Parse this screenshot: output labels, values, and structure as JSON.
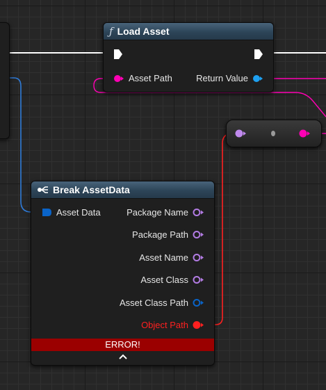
{
  "load_asset_node": {
    "title": "Load Asset",
    "icon": "function-icon",
    "inputs": [
      {
        "label": "Asset Path",
        "color": "#ff00b4"
      }
    ],
    "outputs": [
      {
        "label": "Return Value",
        "color": "#1ea0f0"
      }
    ]
  },
  "break_asset_data_node": {
    "title": "Break AssetData",
    "icon": "break-struct-icon",
    "inputs": [
      {
        "label": "Asset Data",
        "color": "#0a64c8"
      }
    ],
    "outputs": [
      {
        "label": "Package Name",
        "color": "#b37ce4"
      },
      {
        "label": "Package Path",
        "color": "#b37ce4"
      },
      {
        "label": "Asset Name",
        "color": "#b37ce4"
      },
      {
        "label": "Asset Class",
        "color": "#b37ce4"
      },
      {
        "label": "Asset Class Path",
        "color": "#0a64c8"
      },
      {
        "label": "Object Path",
        "color": "#ff2020"
      }
    ],
    "error_label": "ERROR!",
    "expand_icon": "chevron-up-icon"
  },
  "colors": {
    "exec_wire": "#ffffff",
    "soft_object_path_wire": "#ff00b4",
    "struct_wire": "#2f7bd8",
    "name_pin": "#b37ce4",
    "error_red": "#ff2020",
    "error_bar": "#9b0000"
  }
}
